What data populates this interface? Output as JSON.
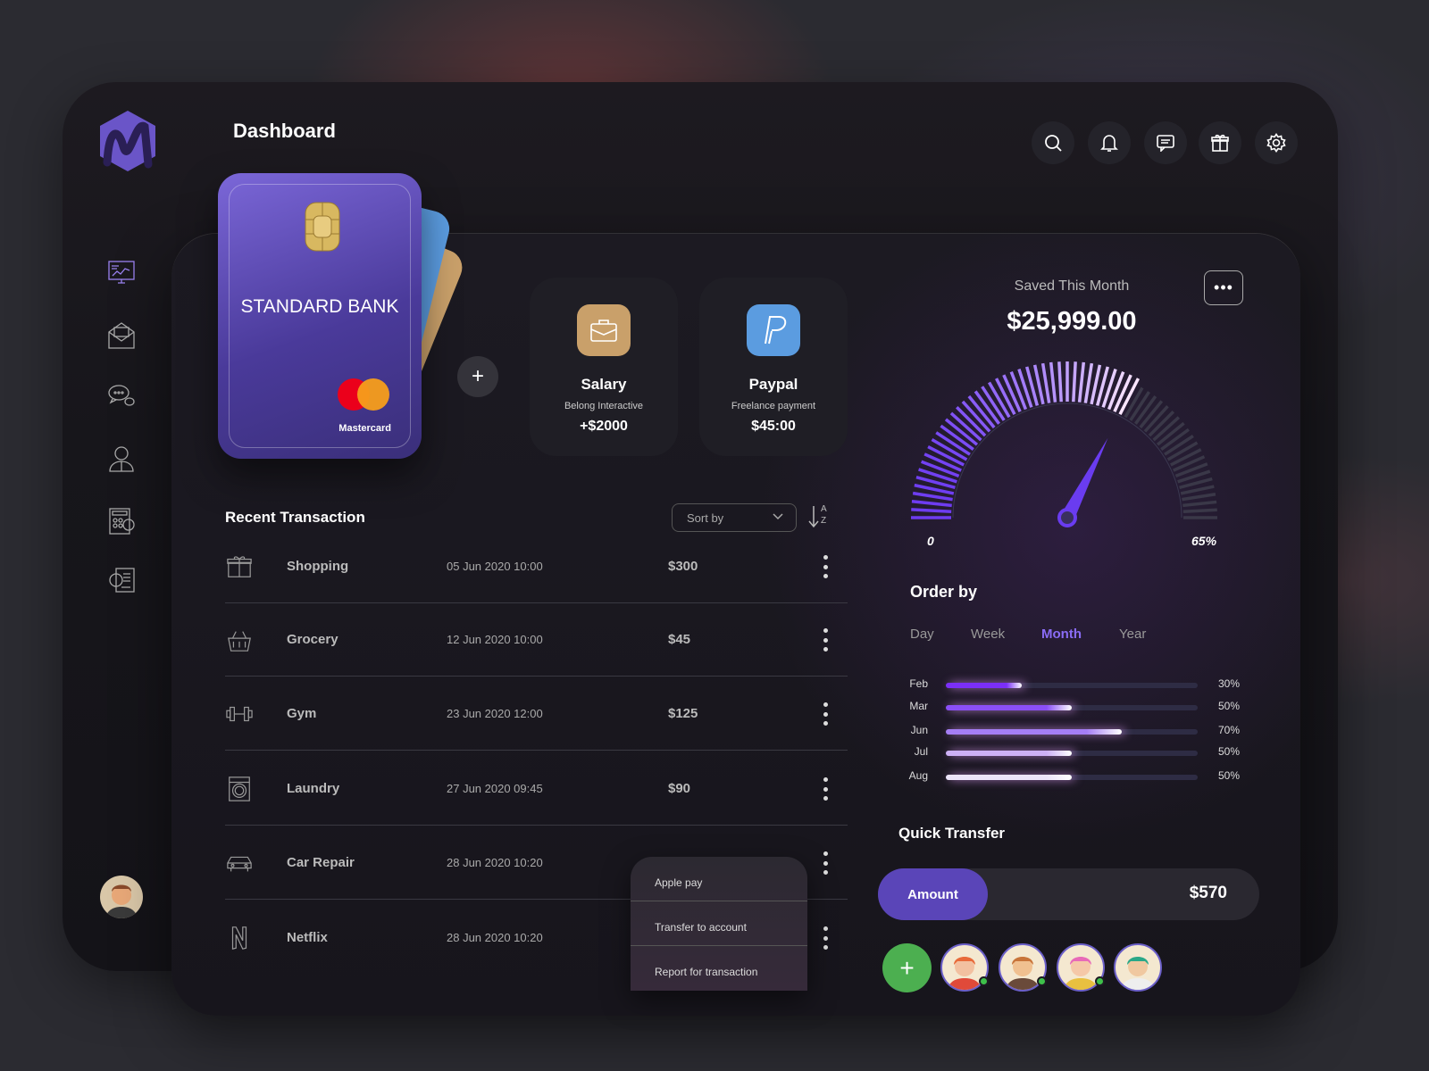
{
  "header": {
    "title": "Dashboard",
    "icons": [
      "search-icon",
      "bell-icon",
      "chat-icon",
      "gift-icon",
      "gear-icon"
    ]
  },
  "sidebar": {
    "items": [
      "monitor-chart-icon",
      "envelope-icon",
      "chat-bubbles-icon",
      "user-icon",
      "calculator-icon",
      "settings-document-icon"
    ]
  },
  "card": {
    "bank": "STANDARD BANK",
    "network": "Mastercard"
  },
  "tiles": [
    {
      "title": "Salary",
      "subtitle": "Belong Interactive",
      "value": "+$2000",
      "color": "#c9a06a"
    },
    {
      "title": "Paypal",
      "subtitle": "Freelance payment",
      "value": "$45:00",
      "color": "#5b9ce0"
    }
  ],
  "transactions": {
    "title": "Recent Transaction",
    "sort_label": "Sort by",
    "sort_a": "A",
    "sort_z": "Z",
    "rows": [
      {
        "name": "Shopping",
        "date": "05 Jun 2020 10:00",
        "amount": "$300",
        "icon": "gift-icon"
      },
      {
        "name": "Grocery",
        "date": "12 Jun 2020 10:00",
        "amount": "$45",
        "icon": "grocery-basket-icon"
      },
      {
        "name": "Gym",
        "date": "23 Jun 2020 12:00",
        "amount": "$125",
        "icon": "dumbbell-icon"
      },
      {
        "name": "Laundry",
        "date": "27 Jun 2020 09:45",
        "amount": "$90",
        "icon": "washing-machine-icon"
      },
      {
        "name": "Car Repair",
        "date": "28 Jun  2020 10:20",
        "amount": "",
        "icon": "car-icon"
      },
      {
        "name": "Netflix",
        "date": "28 Jun  2020 10:20",
        "amount": "",
        "icon": "netflix-icon"
      }
    ]
  },
  "context_menu": [
    "Apple pay",
    "Transfer to  account",
    "Report for transaction"
  ],
  "savings": {
    "label": "Saved This Month",
    "amount": "$25,999.00",
    "gauge_min": "0",
    "gauge_max": "65%",
    "gauge_percent": 65
  },
  "order_by": {
    "title": "Order by",
    "tabs": [
      "Day",
      "Week",
      "Month",
      "Year"
    ],
    "active": "Month",
    "bars": [
      {
        "label": "Feb",
        "percent": 30,
        "text": "30%",
        "color": "#7b2ff7"
      },
      {
        "label": "Mar",
        "percent": 50,
        "text": "50%",
        "color": "#8b4ff7"
      },
      {
        "label": "Jun",
        "percent": 70,
        "text": "70%",
        "color": "#a57ef5"
      },
      {
        "label": "Jul",
        "percent": 50,
        "text": "50%",
        "color": "#cdb0f5"
      },
      {
        "label": "Aug",
        "percent": 50,
        "text": "50%",
        "color": "#ece4fa"
      }
    ]
  },
  "quick_transfer": {
    "title": "Quick Transfer",
    "amount_label": "Amount",
    "amount": "$570"
  },
  "accent": "#6a4cf0"
}
